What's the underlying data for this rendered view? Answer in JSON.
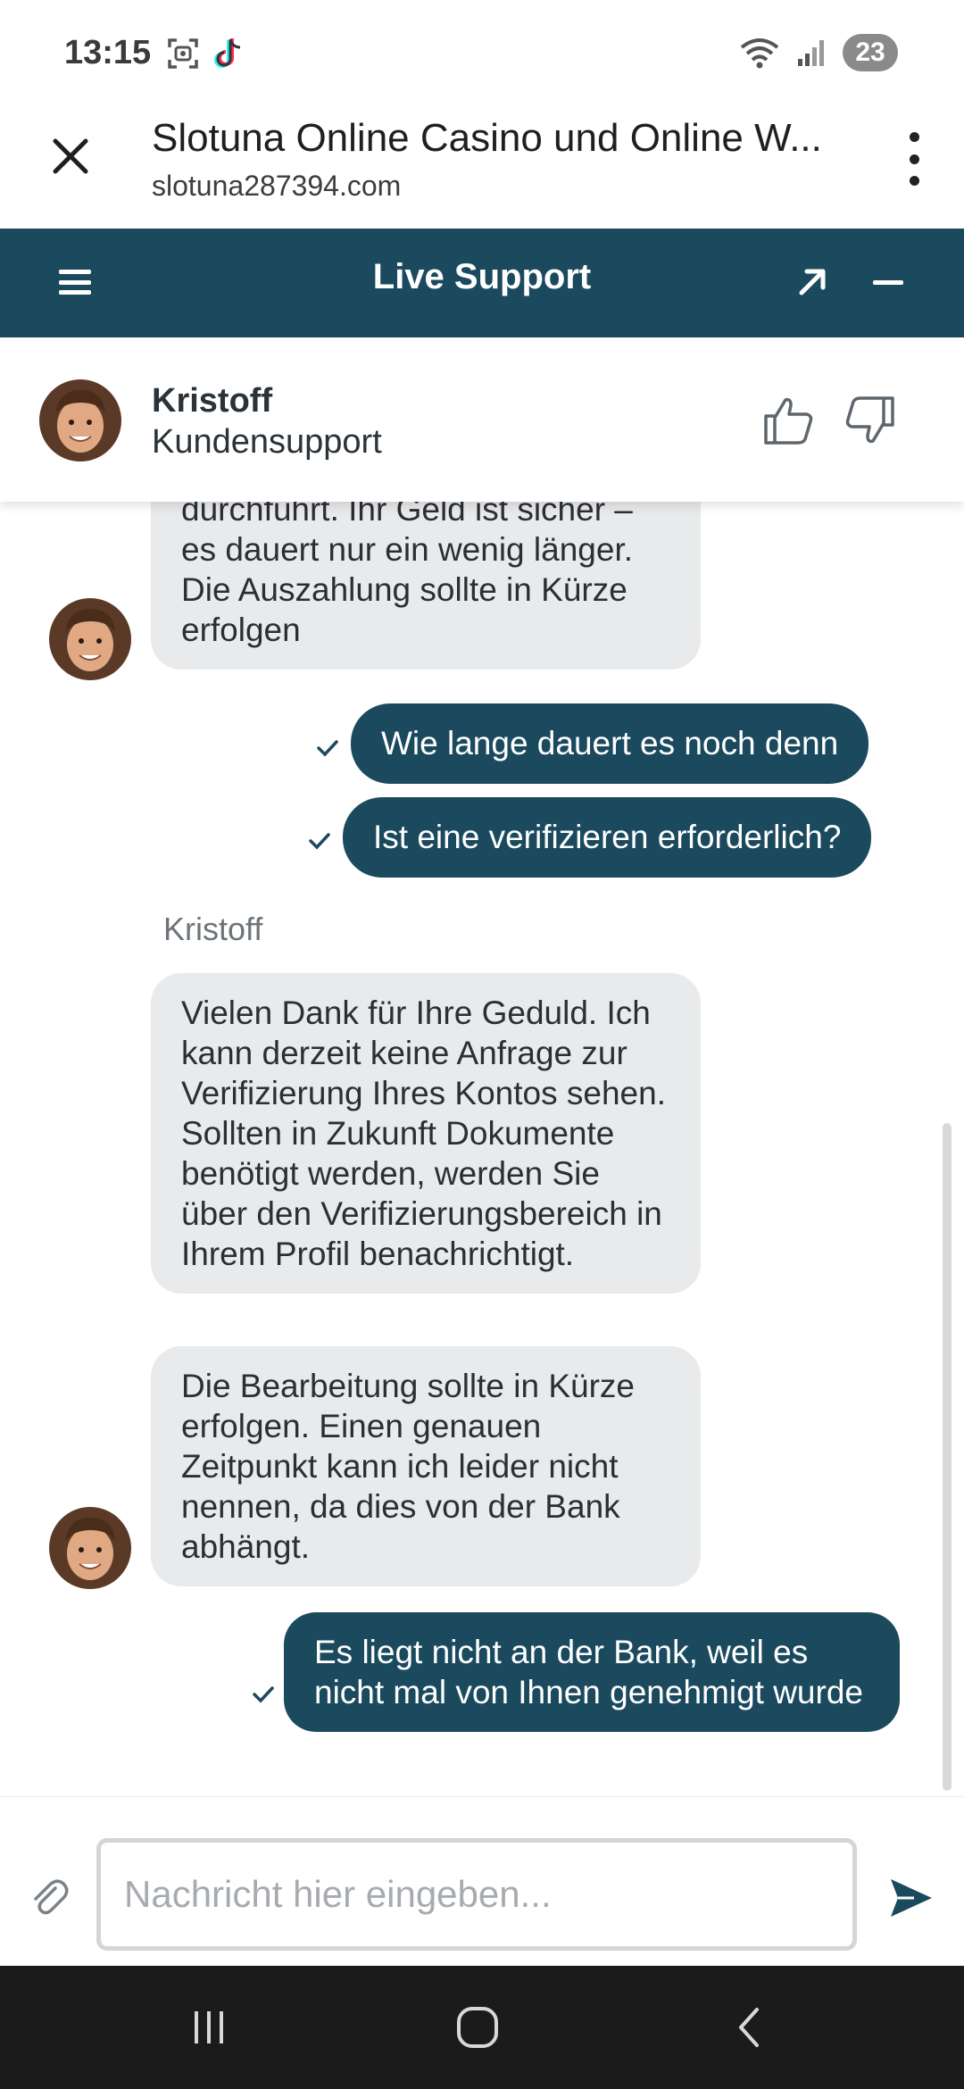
{
  "status_bar": {
    "time": "13:15",
    "battery": "23",
    "icons": [
      "screenshot-icon",
      "tiktok-icon",
      "wifi-icon",
      "signal-icon"
    ]
  },
  "browser": {
    "title": "Slotuna Online Casino und Online W...",
    "url": "slotuna287394.com"
  },
  "support_header": {
    "title": "Live Support",
    "color": "#1b4a5e"
  },
  "agent": {
    "name": "Kristoff",
    "role": "Kundensupport"
  },
  "chat": {
    "messages": [
      {
        "from": "agent",
        "text": "durchführt. Ihr Geld ist sicher – es dauert nur ein wenig länger. Die Auszahlung sollte in Kürze erfolgen"
      },
      {
        "from": "user",
        "text": "Wie lange dauert es noch denn"
      },
      {
        "from": "user",
        "text": "Ist eine verifizieren erforderlich?"
      },
      {
        "from": "agent_label",
        "text": "Kristoff"
      },
      {
        "from": "agent",
        "text": "Vielen Dank für Ihre Geduld. Ich kann derzeit keine Anfrage zur Verifizierung Ihres Kontos sehen. Sollten in Zukunft Dokumente benötigt werden, werden Sie über den Verifizierungsbereich in Ihrem Profil benachrichtigt."
      },
      {
        "from": "agent",
        "text": "Die Bearbeitung sollte in Kürze erfolgen. Einen genauen Zeitpunkt kann ich leider nicht nennen, da dies von der Bank abhängt."
      },
      {
        "from": "user",
        "text": "Es liegt nicht an der Bank, weil es nicht mal von Ihnen genehmigt wurde"
      }
    ]
  },
  "composer": {
    "placeholder": "Nachricht hier eingeben...",
    "value": ""
  }
}
